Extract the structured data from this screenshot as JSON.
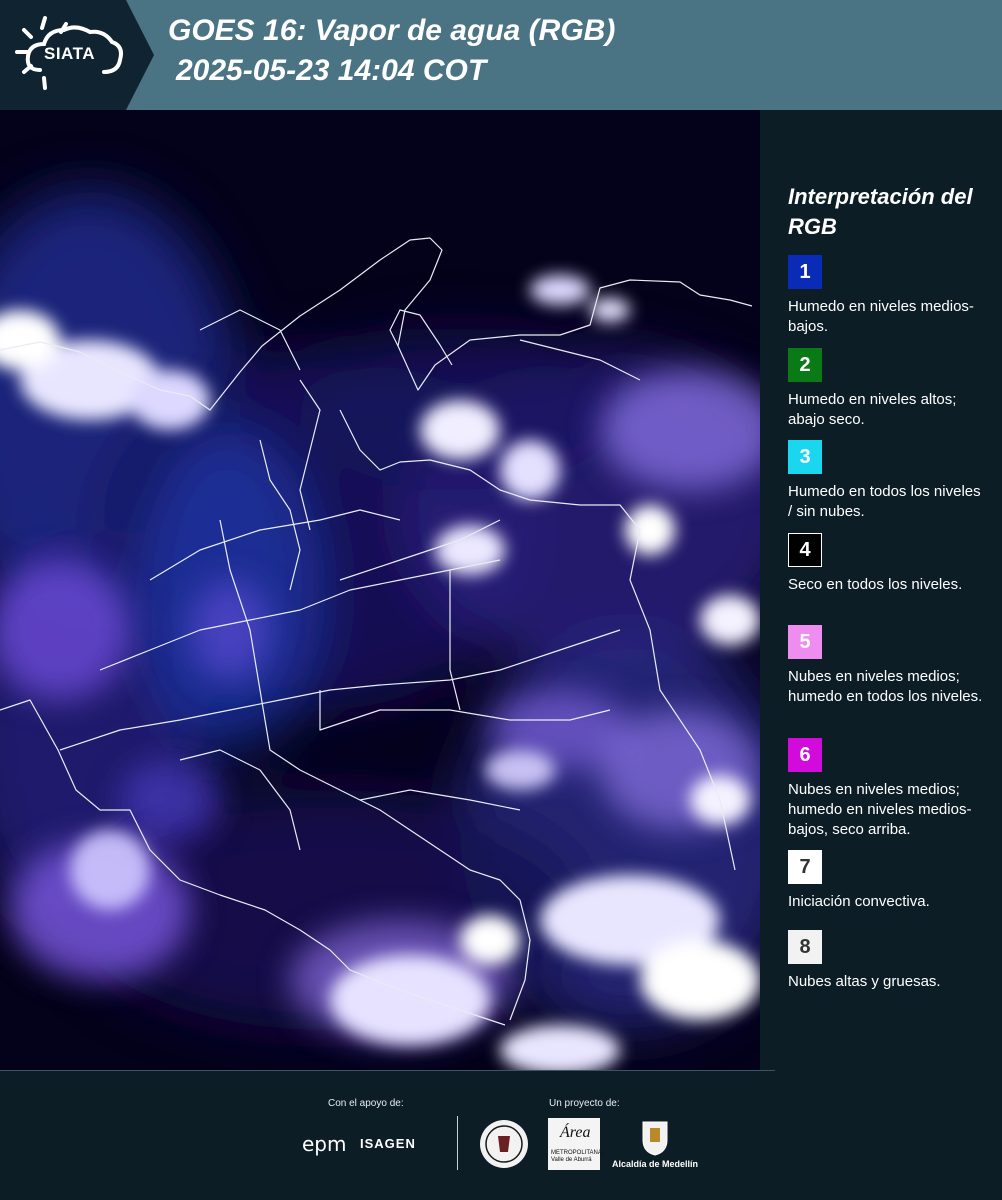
{
  "header": {
    "logo_text": "SIATA",
    "title_line1": "GOES 16: Vapor de agua (RGB)",
    "title_line2": "2025-05-23 14:04 COT"
  },
  "legend": {
    "title": "Interpretación del RGB",
    "items": [
      {
        "number": "1",
        "color": "#0a2bb8",
        "text": "Humedo en niveles medios-bajos."
      },
      {
        "number": "2",
        "color": "#0a7a16",
        "text": "Humedo en niveles altos; abajo seco."
      },
      {
        "number": "3",
        "color": "#1ad6ee",
        "text": "Humedo en todos los niveles / sin nubes."
      },
      {
        "number": "4",
        "color": "#000000",
        "text": "Seco en todos los niveles."
      },
      {
        "number": "5",
        "color": "#ee8cf0",
        "text": "Nubes en niveles medios; humedo en todos los niveles."
      },
      {
        "number": "6",
        "color": "#d20adc",
        "text": "Nubes en niveles medios; humedo en niveles medios-bajos, seco arriba."
      },
      {
        "number": "7",
        "color": "#ffffff",
        "text": "Iniciación convectiva."
      },
      {
        "number": "8",
        "color": "#f2f2f2",
        "text": "Nubes altas y gruesas."
      }
    ]
  },
  "footer": {
    "support_label": "Con el apoyo de:",
    "project_label": "Un proyecto de:",
    "epm": "epm",
    "isagen": "ISAGEN",
    "metro_a": "Área",
    "metro_text": "METROPOLITANA Valle de Aburrá",
    "alcaldia": "Alcaldía de Medellín"
  }
}
